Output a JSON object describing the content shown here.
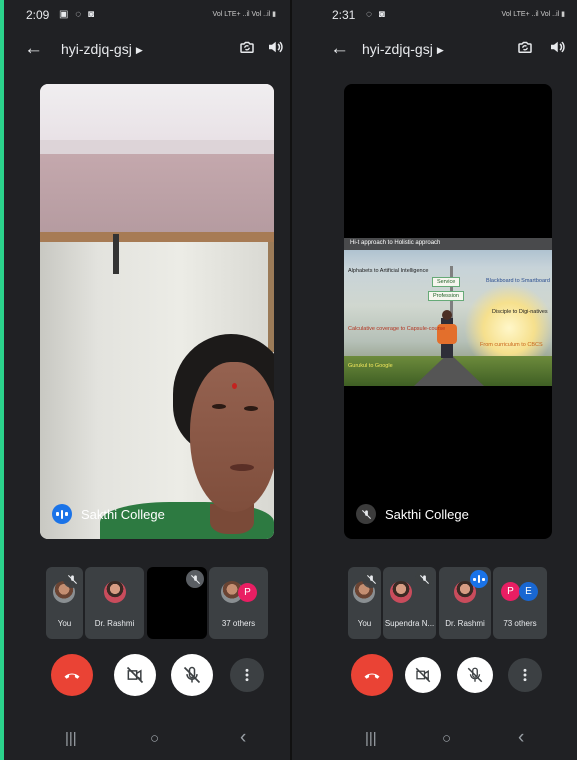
{
  "colors": {
    "background": "#202124",
    "accent_blue": "#1a73e8",
    "end_call_red": "#ea4335",
    "avatar_pink": "#e91e63",
    "avatar_purple": "#ad1457",
    "avatar_blue": "#1967d2"
  },
  "screens": [
    {
      "status_time": "2:09",
      "status_icons": "▣ ◌ ◙",
      "status_network": "Vol LTE+ ..il Vol ..il",
      "meeting_code": "hyi-zdjq-gsj",
      "main_tile": {
        "content": "camera-video",
        "name": "Sakthi College",
        "indicator": "speaking"
      },
      "participants": [
        {
          "label": "You",
          "avatar": "photo",
          "muted": true
        },
        {
          "label": "Dr. Rashmi",
          "avatar": "photo",
          "muted": false
        },
        {
          "label": "",
          "avatar": "none",
          "muted": true
        },
        {
          "label": "37 others",
          "avatar": "photo+P",
          "muted": false
        }
      ],
      "others_letters": [
        "P"
      ],
      "controls": [
        "end-call",
        "camera-off",
        "mic-off",
        "more-options"
      ]
    },
    {
      "status_time": "2:31",
      "status_icons": "◌ ◙",
      "status_network": "Vol LTE+ ..il Vol ..il",
      "meeting_code": "hyi-zdjq-gsj",
      "main_tile": {
        "content": "presentation",
        "name": "Sakthi College",
        "indicator": "muted",
        "slide": {
          "header": "Hi-t approach to Holistic approach",
          "sign_1": "Service",
          "sign_2": "Profession",
          "texts": [
            "Alphabets to Artificial Intelligence",
            "Blackboard to Smartboard",
            "Disciple to Digi-natives",
            "Calculative coverage to Capsule-course",
            "From curriculum to CBCS",
            "Gurukul to Google"
          ]
        }
      },
      "participants": [
        {
          "label": "You",
          "avatar": "photo",
          "muted": true
        },
        {
          "label": "Supendra N...",
          "avatar": "photo",
          "muted": true
        },
        {
          "label": "Dr. Rashmi",
          "avatar": "photo",
          "muted": false,
          "speaking": true
        },
        {
          "label": "73 others",
          "avatar": "letters",
          "muted": false
        }
      ],
      "others_letters": [
        "P",
        "E"
      ],
      "controls": [
        "end-call",
        "camera-off",
        "mic-off",
        "more-options"
      ]
    }
  ],
  "nav": {
    "recents": "|||",
    "home": "○",
    "back": "‹"
  }
}
